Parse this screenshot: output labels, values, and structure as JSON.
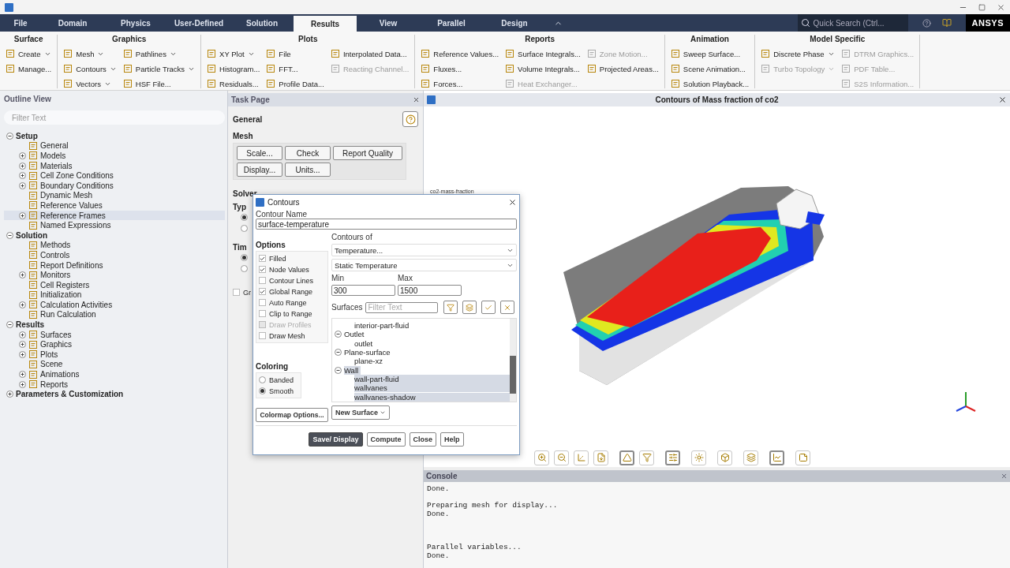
{
  "menu_tabs": [
    {
      "label": "File",
      "selected": false
    },
    {
      "label": "Domain",
      "selected": false
    },
    {
      "label": "Physics",
      "selected": false
    },
    {
      "label": "User-Defined",
      "selected": false
    },
    {
      "label": "Solution",
      "selected": false
    },
    {
      "label": "Results",
      "selected": true
    },
    {
      "label": "View",
      "selected": false
    },
    {
      "label": "Parallel",
      "selected": false
    },
    {
      "label": "Design",
      "selected": false
    }
  ],
  "quick_search": {
    "placeholder": "Quick Search (Ctrl..."
  },
  "brand": "ANSYS",
  "ribbon": [
    {
      "title": "Surface",
      "columns": [
        [
          {
            "label": "Create",
            "dropdown": true,
            "disabled": false
          },
          {
            "label": "Manage...",
            "dropdown": false,
            "disabled": false
          }
        ]
      ]
    },
    {
      "title": "Graphics",
      "columns": [
        [
          {
            "label": "Mesh",
            "dropdown": true,
            "disabled": false
          },
          {
            "label": "Contours",
            "dropdown": true,
            "disabled": false
          },
          {
            "label": "Vectors",
            "dropdown": true,
            "disabled": false
          }
        ],
        [
          {
            "label": "Pathlines",
            "dropdown": true,
            "disabled": false
          },
          {
            "label": "Particle Tracks",
            "dropdown": true,
            "disabled": false
          },
          {
            "label": "HSF File...",
            "dropdown": false,
            "disabled": false
          }
        ]
      ]
    },
    {
      "title": "Plots",
      "columns": [
        [
          {
            "label": "XY Plot",
            "dropdown": true,
            "disabled": false
          },
          {
            "label": "Histogram...",
            "dropdown": false,
            "disabled": false
          },
          {
            "label": "Residuals...",
            "dropdown": false,
            "disabled": false
          }
        ],
        [
          {
            "label": "File",
            "dropdown": false,
            "disabled": false
          },
          {
            "label": "FFT...",
            "dropdown": false,
            "disabled": false
          },
          {
            "label": "Profile Data...",
            "dropdown": false,
            "disabled": false
          }
        ],
        [
          {
            "label": "Interpolated Data...",
            "dropdown": false,
            "disabled": false
          },
          {
            "label": "Reacting Channel...",
            "dropdown": false,
            "disabled": true
          }
        ]
      ]
    },
    {
      "title": "Reports",
      "columns": [
        [
          {
            "label": "Reference Values...",
            "dropdown": false,
            "disabled": false
          },
          {
            "label": "Fluxes...",
            "dropdown": false,
            "disabled": false
          },
          {
            "label": "Forces...",
            "dropdown": false,
            "disabled": false
          }
        ],
        [
          {
            "label": "Surface Integrals...",
            "dropdown": false,
            "disabled": false
          },
          {
            "label": "Volume Integrals...",
            "dropdown": false,
            "disabled": false
          },
          {
            "label": "Heat Exchanger...",
            "dropdown": false,
            "disabled": true
          }
        ],
        [
          {
            "label": "Zone Motion...",
            "dropdown": false,
            "disabled": true
          },
          {
            "label": "Projected Areas...",
            "dropdown": false,
            "disabled": false
          }
        ]
      ]
    },
    {
      "title": "Animation",
      "columns": [
        [
          {
            "label": "Sweep Surface...",
            "dropdown": false,
            "disabled": false
          },
          {
            "label": "Scene Animation...",
            "dropdown": false,
            "disabled": false
          },
          {
            "label": "Solution Playback...",
            "dropdown": false,
            "disabled": false
          }
        ]
      ]
    },
    {
      "title": "Model Specific",
      "columns": [
        [
          {
            "label": "Discrete Phase",
            "dropdown": true,
            "disabled": false
          },
          {
            "label": "Turbo Topology",
            "dropdown": true,
            "disabled": true
          }
        ],
        [
          {
            "label": "DTRM Graphics...",
            "dropdown": false,
            "disabled": true
          },
          {
            "label": "PDF Table...",
            "dropdown": false,
            "disabled": true
          },
          {
            "label": "S2S Information...",
            "dropdown": false,
            "disabled": true
          }
        ]
      ]
    }
  ],
  "outline": {
    "title": "Outline View",
    "filter": {
      "placeholder": "Filter Text"
    },
    "tree": [
      {
        "label": "Setup",
        "expanded": true,
        "selected": false,
        "children": [
          {
            "label": "General",
            "selected": false
          },
          {
            "label": "Models",
            "expanded": false,
            "selected": false
          },
          {
            "label": "Materials",
            "expanded": false,
            "selected": false
          },
          {
            "label": "Cell Zone Conditions",
            "expanded": false,
            "selected": false
          },
          {
            "label": "Boundary Conditions",
            "expanded": false,
            "selected": false
          },
          {
            "label": "Dynamic Mesh",
            "selected": false
          },
          {
            "label": "Reference Values",
            "selected": false
          },
          {
            "label": "Reference Frames",
            "expanded": false,
            "selected": true
          },
          {
            "label": "Named Expressions",
            "selected": false
          }
        ]
      },
      {
        "label": "Solution",
        "expanded": true,
        "selected": false,
        "children": [
          {
            "label": "Methods",
            "selected": false
          },
          {
            "label": "Controls",
            "selected": false
          },
          {
            "label": "Report Definitions",
            "selected": false
          },
          {
            "label": "Monitors",
            "expanded": false,
            "selected": false
          },
          {
            "label": "Cell Registers",
            "selected": false
          },
          {
            "label": "Initialization",
            "selected": false
          },
          {
            "label": "Calculation Activities",
            "expanded": false,
            "selected": false
          },
          {
            "label": "Run Calculation",
            "selected": false
          }
        ]
      },
      {
        "label": "Results",
        "expanded": true,
        "selected": false,
        "children": [
          {
            "label": "Surfaces",
            "expanded": false,
            "selected": false
          },
          {
            "label": "Graphics",
            "expanded": false,
            "selected": false
          },
          {
            "label": "Plots",
            "expanded": false,
            "selected": false
          },
          {
            "label": "Scene",
            "selected": false
          },
          {
            "label": "Animations",
            "expanded": false,
            "selected": false
          },
          {
            "label": "Reports",
            "expanded": false,
            "selected": false
          }
        ]
      },
      {
        "label": "Parameters & Customization",
        "expanded": false,
        "selected": false
      }
    ]
  },
  "task_page": {
    "title": "Task Page",
    "heading": "General",
    "mesh_title": "Mesh",
    "mesh_buttons": [
      "Scale...",
      "Check",
      "Report Quality",
      "Display...",
      "Units..."
    ],
    "solver_title": "Solver",
    "type_label": "Typ",
    "type_radios": [
      {
        "selected": true
      },
      {
        "selected": false
      }
    ],
    "time_label": "Tim",
    "time_radios": [
      {
        "selected": true
      },
      {
        "selected": false
      }
    ],
    "gravity": {
      "label": "Gr",
      "checked": false
    }
  },
  "dialog": {
    "title": "Contours",
    "name_label": "Contour Name",
    "name_value": "surface-temperature",
    "options_title": "Options",
    "options": [
      {
        "label": "Filled",
        "checked": true,
        "disabled": false
      },
      {
        "label": "Node Values",
        "checked": true,
        "disabled": false
      },
      {
        "label": "Contour Lines",
        "checked": false,
        "disabled": false
      },
      {
        "label": "Global Range",
        "checked": true,
        "disabled": false
      },
      {
        "label": "Auto Range",
        "checked": false,
        "disabled": false
      },
      {
        "label": "Clip to Range",
        "checked": false,
        "disabled": false
      },
      {
        "label": "Draw Profiles",
        "checked": false,
        "disabled": true
      },
      {
        "label": "Draw Mesh",
        "checked": false,
        "disabled": false
      }
    ],
    "coloring_title": "Coloring",
    "coloring": [
      {
        "label": "Banded",
        "selected": false
      },
      {
        "label": "Smooth",
        "selected": true
      }
    ],
    "colormap_button": "Colormap Options...",
    "contours_of_label": "Contours of",
    "contours_of": [
      "Temperature...",
      "Static Temperature"
    ],
    "min_label": "Min",
    "min_value": "300",
    "max_label": "Max",
    "max_value": "1500",
    "surfaces_label": "Surfaces",
    "surfaces_filter": {
      "placeholder": "Filter Text"
    },
    "surfaces": [
      {
        "label": "interior-part-fluid",
        "selected": false
      },
      {
        "label": "Outlet",
        "expanded": true,
        "selected": false,
        "children": [
          {
            "label": "outlet",
            "selected": false
          }
        ]
      },
      {
        "label": "Plane-surface",
        "expanded": true,
        "selected": false,
        "children": [
          {
            "label": "plane-xz",
            "selected": false
          }
        ]
      },
      {
        "label": "Wall",
        "expanded": true,
        "selected": true,
        "children": [
          {
            "label": "wall-part-fluid",
            "selected": true
          },
          {
            "label": "wallvanes",
            "selected": true
          },
          {
            "label": "wallvanes-shadow",
            "selected": true
          }
        ]
      }
    ],
    "new_surface_button": "New Surface",
    "buttons": [
      {
        "label": "Save/ Display",
        "primary": true
      },
      {
        "label": "Compute",
        "primary": false
      },
      {
        "label": "Close",
        "primary": false
      },
      {
        "label": "Help",
        "primary": false
      }
    ]
  },
  "graphics": {
    "title": "Contours of Mass fraction of co2",
    "legend_label": "co2-mass-fraction",
    "toolbar": [
      {
        "pressed": false
      },
      {
        "pressed": false
      },
      {
        "pressed": false
      },
      {
        "pressed": false
      },
      {
        "pressed": true
      },
      {
        "pressed": false
      },
      {
        "pressed": true
      },
      {
        "pressed": false
      },
      {
        "pressed": false
      },
      {
        "pressed": false
      },
      {
        "pressed": true
      },
      {
        "pressed": false
      }
    ]
  },
  "console": {
    "title": "Console",
    "blocks": [
      [
        "Done."
      ],
      [
        "Preparing mesh for display...",
        "Done."
      ],
      [
        "Parallel variables...",
        "Done."
      ]
    ]
  }
}
